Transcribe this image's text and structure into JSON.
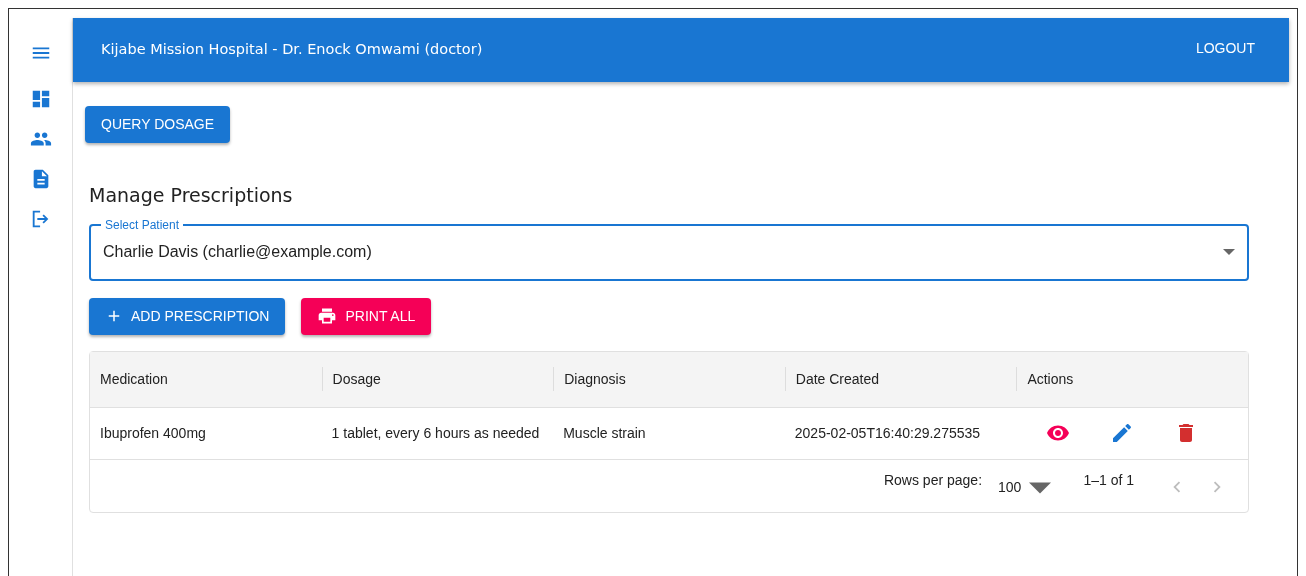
{
  "sidebar": {
    "items": [
      {
        "kind": "menu"
      },
      {
        "kind": "dashboard"
      },
      {
        "kind": "people"
      },
      {
        "kind": "document"
      },
      {
        "kind": "logout"
      }
    ]
  },
  "app_bar": {
    "title": "Kijabe Mission Hospital - Dr. Enock Omwami (doctor)",
    "logout": "LOGOUT"
  },
  "query_button": "QUERY DOSAGE",
  "heading": "Manage Prescriptions",
  "patient_select": {
    "label": "Select Patient",
    "value": "Charlie Davis (charlie@example.com)"
  },
  "buttons": [
    {
      "kind": "add",
      "label": "ADD PRESCRIPTION"
    },
    {
      "kind": "print",
      "label": "PRINT ALL"
    }
  ],
  "table": {
    "columns": [
      "Medication",
      "Dosage",
      "Diagnosis",
      "Date Created",
      "Actions"
    ],
    "rows": [
      {
        "cells": [
          "Ibuprofen 400mg",
          "1 tablet, every 6 hours as needed",
          "Muscle strain",
          "2025-02-05T16:40:29.275535"
        ],
        "actions": [
          {
            "kind": "view"
          },
          {
            "kind": "edit"
          },
          {
            "kind": "delete"
          }
        ]
      }
    ]
  },
  "pagination": {
    "rows_per_page_label": "Rows per page:",
    "rows_per_page": "100",
    "range": "1–1 of 1",
    "previous_disabled": true,
    "next_disabled": true
  }
}
